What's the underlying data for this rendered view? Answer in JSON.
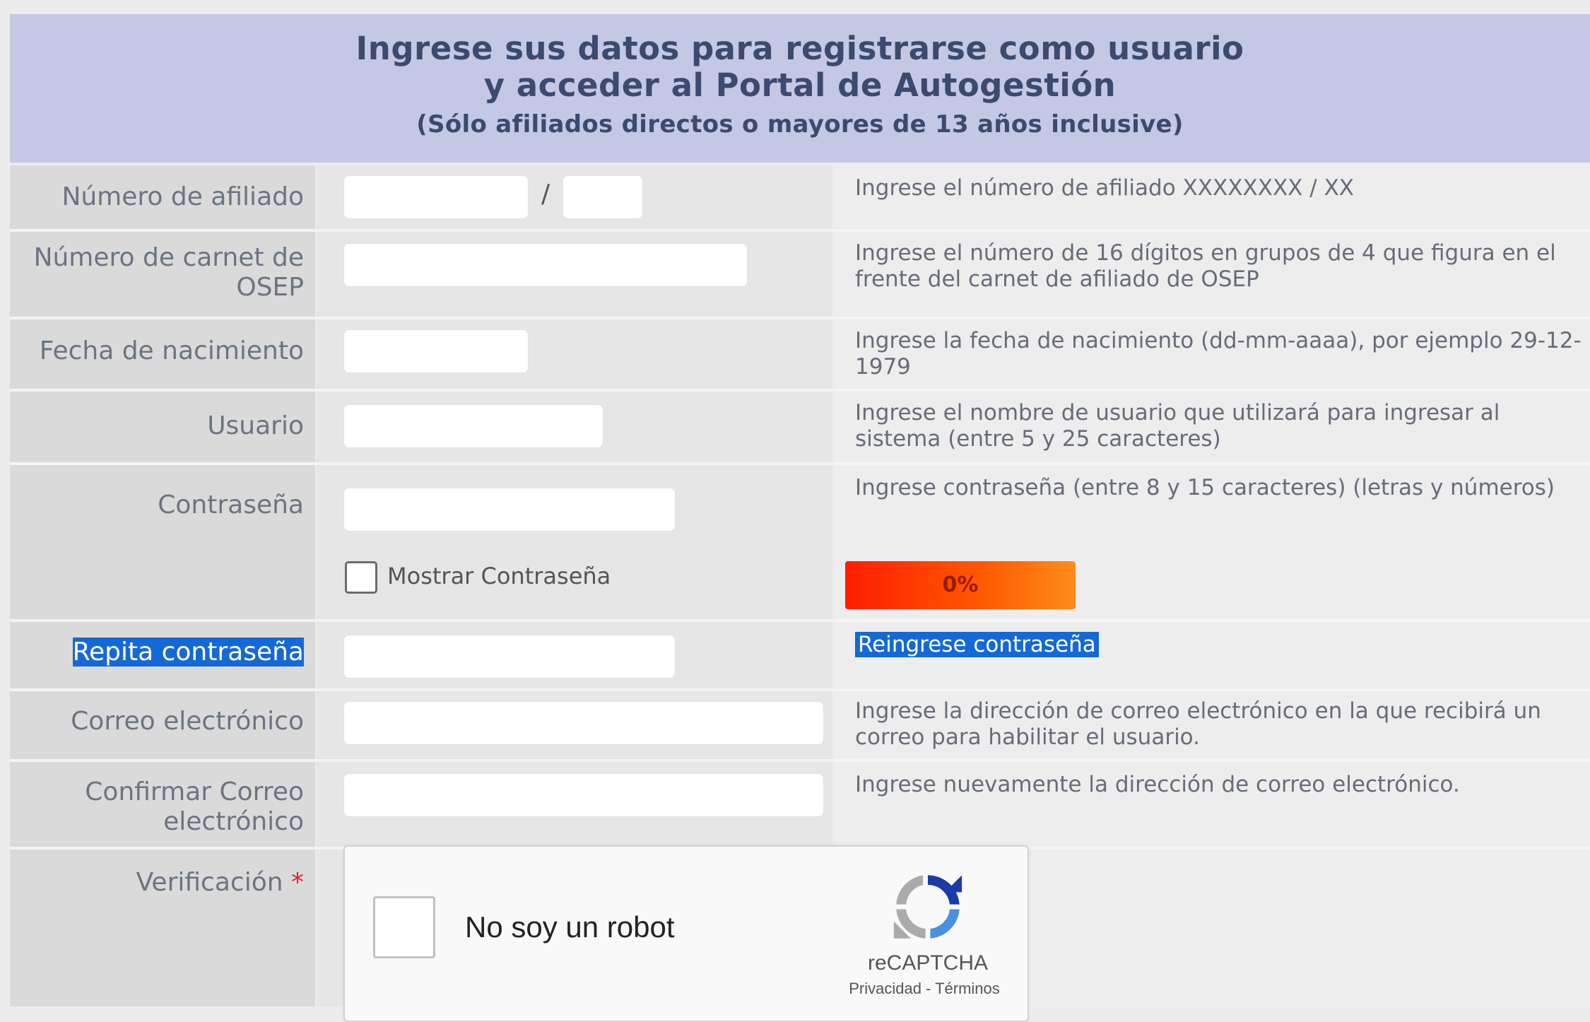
{
  "header": {
    "line1": "Ingrese sus datos para registrarse como usuario",
    "line2": "y acceder al Portal de Autogestión",
    "line3": "(Sólo afiliados directos o mayores de 13 años inclusive)"
  },
  "fields": {
    "afiliado": {
      "label": "Número de afiliado",
      "separator": "/",
      "help": "Ingrese el número de afiliado XXXXXXXX / XX"
    },
    "carnet": {
      "label_line1": "Número de carnet de",
      "label_line2": "OSEP",
      "help": "Ingrese el número de 16 dígitos en grupos de 4 que figura en el frente del carnet de afiliado de OSEP"
    },
    "nacimiento": {
      "label": "Fecha de nacimiento",
      "help": "Ingrese la fecha de nacimiento (dd-mm-aaaa), por ejemplo 29-12-1979"
    },
    "usuario": {
      "label": "Usuario",
      "help": "Ingrese el nombre de usuario que utilizará para ingresar al sistema (entre 5 y 25 caracteres)"
    },
    "contrasena": {
      "label": "Contraseña",
      "help": "Ingrese contraseña (entre 8 y 15 caracteres) (letras y números)",
      "show_label": "Mostrar Contraseña",
      "strength_text": "0%",
      "strength_percent": 0
    },
    "repita": {
      "label": "Repita contraseña",
      "help": "Reingrese contraseña"
    },
    "correo": {
      "label": "Correo electrónico",
      "help": "Ingrese la dirección de correo electrónico en la que recibirá un correo para habilitar el usuario."
    },
    "confirmar": {
      "label_line1": "Confirmar Correo",
      "label_line2": "electrónico",
      "help": "Ingrese nuevamente la dirección de correo electrónico."
    },
    "verificacion": {
      "label": "Verificación",
      "required_mark": "*"
    }
  },
  "captcha": {
    "checkbox_label": "No soy un robot",
    "brand": "reCAPTCHA",
    "links": "Privacidad - Términos",
    "icon": "recaptcha-logo-icon"
  },
  "colors": {
    "header_bg": "#c5c8e4",
    "header_text": "#3b4a6e",
    "highlight": "#1569d6",
    "strength_bar": "#ff3c00"
  }
}
